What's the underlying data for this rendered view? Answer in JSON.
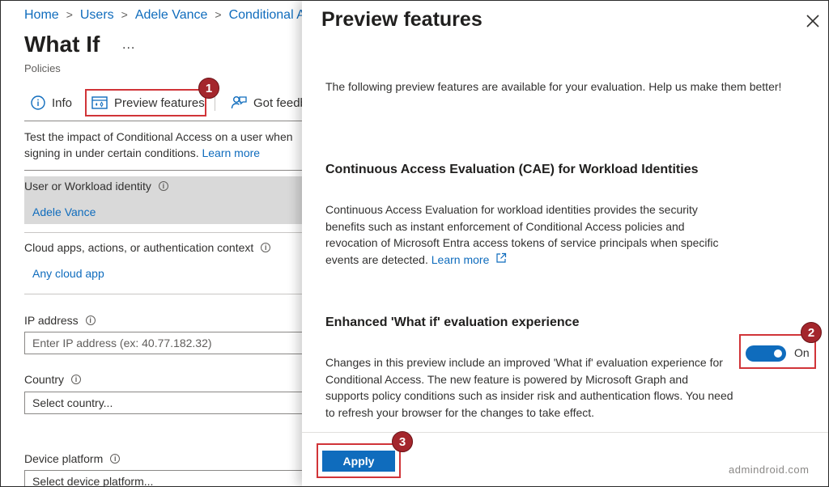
{
  "breadcrumb": {
    "items": [
      "Home",
      "Users",
      "Adele Vance",
      "Conditional Access"
    ]
  },
  "page": {
    "title": "What If",
    "more": "...",
    "subtitle": "Policies"
  },
  "toolbar": {
    "info_label": "Info",
    "preview_label": "Preview features",
    "feedback_label": "Got feedback?"
  },
  "annotations": {
    "step1": "1",
    "step2": "2",
    "step3": "3"
  },
  "description": {
    "text": "Test the impact of Conditional Access on a user when signing in under certain conditions. ",
    "learn_more": "Learn more"
  },
  "form": {
    "user_label": "User or Workload identity",
    "user_value": "Adele Vance",
    "apps_label": "Cloud apps, actions, or authentication context",
    "apps_value": "Any cloud app",
    "ip_label": "IP address",
    "ip_placeholder": "Enter IP address (ex: 40.77.182.32)",
    "country_label": "Country",
    "country_value": "Select country...",
    "device_label": "Device platform",
    "device_value": "Select device platform..."
  },
  "panel": {
    "title": "Preview features",
    "intro": "The following preview features are available for your evaluation. Help us make them better!",
    "cae_heading": "Continuous Access Evaluation (CAE) for Workload Identities",
    "cae_text": "Continuous Access Evaluation for workload identities provides the security benefits such as instant enforcement of Conditional Access policies and revocation of Microsoft Entra access tokens of service principals when specific events are detected. ",
    "cae_learn_more": "Learn more",
    "whatif_heading": "Enhanced 'What if' evaluation experience",
    "whatif_text": "Changes in this preview include an improved 'What if' evaluation experience for Conditional Access. The new feature is powered by Microsoft Graph and supports policy conditions such as insider risk and authentication flows. You need to refresh your browser for the changes to take effect.",
    "toggle_label": "On",
    "apply_label": "Apply"
  },
  "watermark": "admindroid.com",
  "colors": {
    "accent": "#0f6cbd",
    "highlight": "#d13438",
    "badge": "#a4262c"
  }
}
